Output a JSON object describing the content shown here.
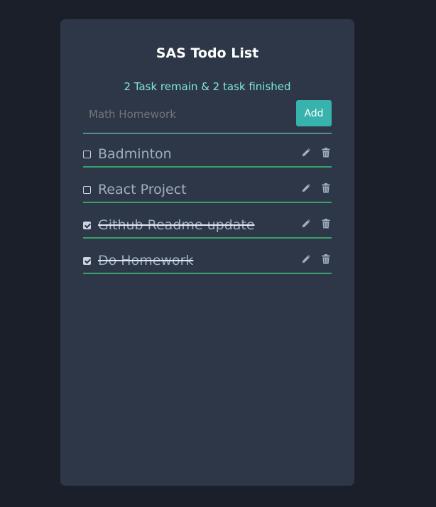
{
  "app": {
    "title": "SAS Todo List",
    "status": "2 Task remain & 2 task finished"
  },
  "input": {
    "value": "",
    "placeholder": "Math Homework",
    "add_label": "Add"
  },
  "todos": [
    {
      "label": "Badminton",
      "done": false
    },
    {
      "label": "React Project",
      "done": false
    },
    {
      "label": "Github Readme update",
      "done": true
    },
    {
      "label": "Do Homework",
      "done": true
    }
  ],
  "icons": {
    "edit": "pencil-icon",
    "delete": "trash-icon"
  },
  "colors": {
    "background": "#1b1f2a",
    "card": "#2d3748",
    "accent": "#38b2ac",
    "status_text": "#81e6d9",
    "item_border": "#38a169"
  }
}
